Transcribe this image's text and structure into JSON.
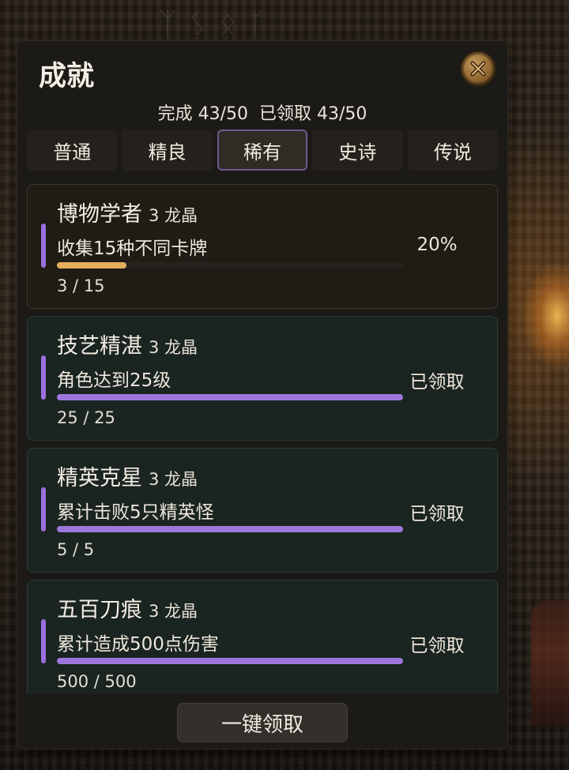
{
  "background": {
    "runes": "ᛉᛊᛟᚴ"
  },
  "panel": {
    "title": "成就",
    "close_icon": "close-x-icon",
    "summary": "完成 43/50  已领取 43/50"
  },
  "tabs": [
    {
      "label": "普通",
      "active": false
    },
    {
      "label": "精良",
      "active": false
    },
    {
      "label": "稀有",
      "active": true
    },
    {
      "label": "史诗",
      "active": false
    },
    {
      "label": "传说",
      "active": false
    }
  ],
  "achievements": [
    {
      "name": "博物学者",
      "reward": "3 龙晶",
      "desc": "收集15种不同卡牌",
      "count": "3 / 15",
      "progress": 0.2,
      "status": "20%",
      "claimed": false
    },
    {
      "name": "技艺精湛",
      "reward": "3 龙晶",
      "desc": "角色达到25级",
      "count": "25 / 25",
      "progress": 1.0,
      "status": "已领取",
      "claimed": true
    },
    {
      "name": "精英克星",
      "reward": "3 龙晶",
      "desc": "累计击败5只精英怪",
      "count": "5 / 5",
      "progress": 1.0,
      "status": "已领取",
      "claimed": true
    },
    {
      "name": "五百刀痕",
      "reward": "3 龙晶",
      "desc": "累计造成500点伤害",
      "count": "500 / 500",
      "progress": 1.0,
      "status": "已领取",
      "claimed": true
    }
  ],
  "footer": {
    "claim_all_label": "一键领取"
  },
  "colors": {
    "accent_purple": "#9a6fe0",
    "bar_complete": "#9d78dc",
    "bar_in_progress": "#e5ae5c",
    "close_button_gold": "#b8884b"
  }
}
